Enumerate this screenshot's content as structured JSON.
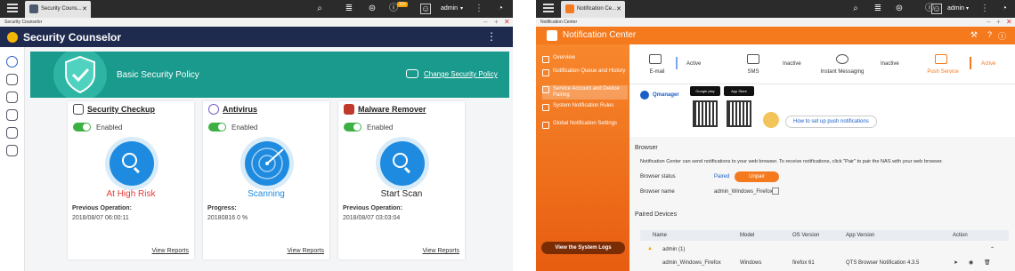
{
  "left": {
    "tab_label": "Security Couns...",
    "user": "admin",
    "notif_badge": "10+",
    "window_title": "Security Counselor",
    "app_title": "Security Counselor",
    "banner": {
      "policy": "Basic Security Policy",
      "change": "Change Security Policy"
    },
    "cards": [
      {
        "title": "Security Checkup",
        "enabled": "Enabled",
        "status": "At High Risk",
        "status_color": "#e53935",
        "prev_label": "Previous Operation:",
        "prev_value": "2018/08/07 06:00:11",
        "view": "View Reports",
        "icon": "shield-check-icon"
      },
      {
        "title": "Antivirus",
        "enabled": "Enabled",
        "status": "Scanning",
        "status_color": "#1e8be0",
        "prev_label": "Progress:",
        "prev_value": "20180816 0 %",
        "view": "View Reports",
        "icon": "antivirus-icon"
      },
      {
        "title": "Malware Remover",
        "enabled": "Enabled",
        "status": "Start Scan",
        "status_color": "#222",
        "prev_label": "Previous Operation:",
        "prev_value": "2018/08/07 03:03:04",
        "view": "View Reports",
        "icon": "malware-remover-icon"
      }
    ]
  },
  "right": {
    "tab_label": "Notification Ce...",
    "user": "admin",
    "window_title": "Notification Center",
    "app_title": "Notification Center",
    "sidebar": [
      {
        "label": "Overview"
      },
      {
        "label": "Notification Queue and History"
      },
      {
        "label": "Service Account and Device Pairing"
      },
      {
        "label": "System Notification Rules"
      },
      {
        "label": "Global Notification Settings"
      }
    ],
    "view_logs": "View the System Logs",
    "services": [
      {
        "name": "E-mail",
        "status": "Active"
      },
      {
        "name": "SMS",
        "status": "Inactive"
      },
      {
        "name": "Instant Messaging",
        "status": "Inactive"
      },
      {
        "name": "Push Service",
        "status": "Active"
      }
    ],
    "qmanager": "Qmanager",
    "google_play": "Google play",
    "app_store": "App Store",
    "push_link": "How to set up push notifications",
    "browser": {
      "heading": "Browser",
      "desc": "Notification Center can send notifications to your web browser. To receive notifications, click \"Pair\" to pair the NAS with your web browser.",
      "status_label": "Browser status",
      "status_value": "Paired",
      "unpair": "Unpair",
      "name_label": "Browser name",
      "name_value": "admin_Windows_Firefox"
    },
    "paired": {
      "heading": "Paired Devices",
      "columns": [
        "Name",
        "Model",
        "OS Version",
        "App Version",
        "Action"
      ],
      "group": "admin (1)",
      "row": {
        "name": "admin_Windows_Firefox",
        "model": "Windows",
        "os": "firefox 61",
        "app": "QTS Browser Notification 4.3.5"
      }
    }
  }
}
